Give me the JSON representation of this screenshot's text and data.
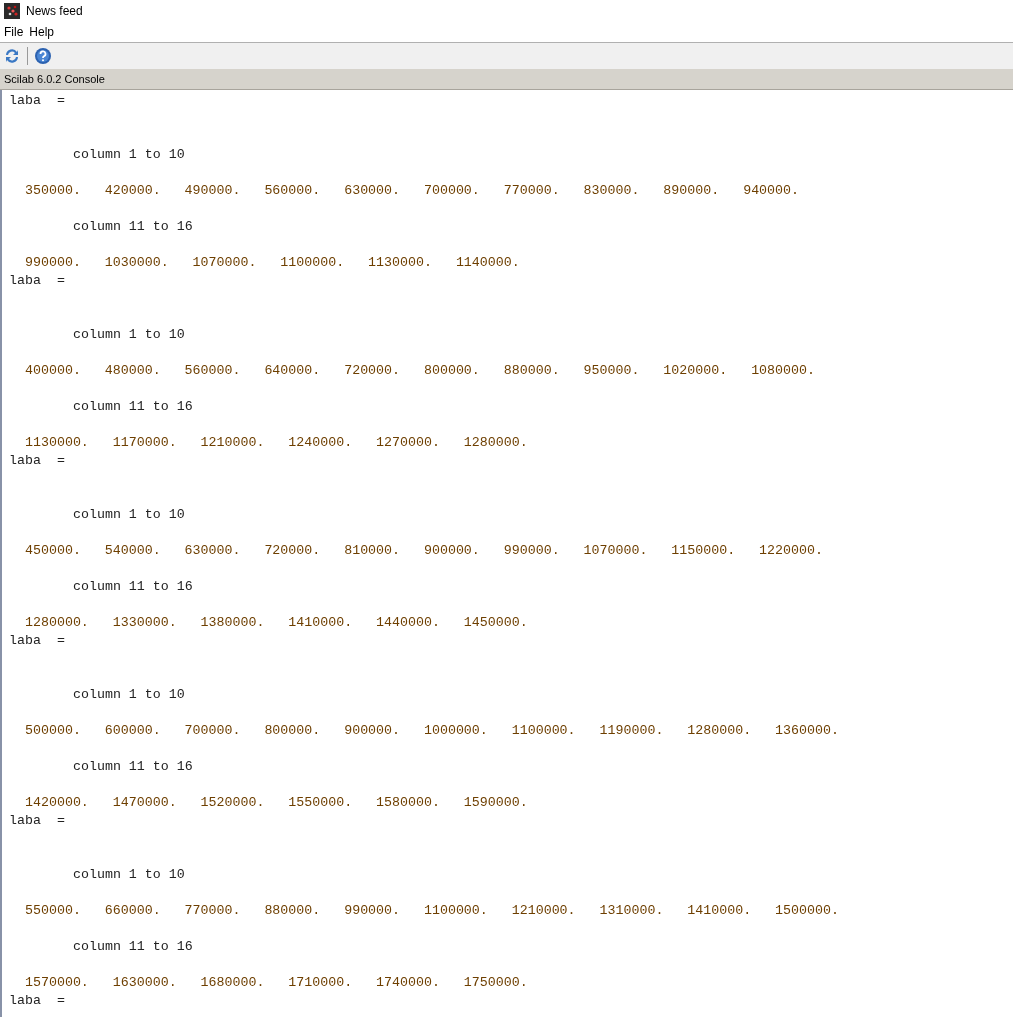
{
  "window": {
    "title": "News feed"
  },
  "menu": [
    "File",
    "Help"
  ],
  "toolbar": [
    {
      "kind": "refresh"
    },
    {
      "kind": "help"
    }
  ],
  "console": {
    "title": "Scilab 6.0.2 Console",
    "blocks": [
      {
        "name": "laba  =",
        "parts": [
          {
            "header": "column 1 to 10",
            "values": "350000.   420000.   490000.   560000.   630000.   700000.   770000.   830000.   890000.   940000."
          },
          {
            "header": "column 11 to 16",
            "values": "990000.   1030000.   1070000.   1100000.   1130000.   1140000."
          }
        ]
      },
      {
        "name": "laba  =",
        "parts": [
          {
            "header": "column 1 to 10",
            "values": "400000.   480000.   560000.   640000.   720000.   800000.   880000.   950000.   1020000.   1080000."
          },
          {
            "header": "column 11 to 16",
            "values": "1130000.   1170000.   1210000.   1240000.   1270000.   1280000."
          }
        ]
      },
      {
        "name": "laba  =",
        "parts": [
          {
            "header": "column 1 to 10",
            "values": "450000.   540000.   630000.   720000.   810000.   900000.   990000.   1070000.   1150000.   1220000."
          },
          {
            "header": "column 11 to 16",
            "values": "1280000.   1330000.   1380000.   1410000.   1440000.   1450000."
          }
        ]
      },
      {
        "name": "laba  =",
        "parts": [
          {
            "header": "column 1 to 10",
            "values": "500000.   600000.   700000.   800000.   900000.   1000000.   1100000.   1190000.   1280000.   1360000."
          },
          {
            "header": "column 11 to 16",
            "values": "1420000.   1470000.   1520000.   1550000.   1580000.   1590000."
          }
        ]
      },
      {
        "name": "laba  =",
        "parts": [
          {
            "header": "column 1 to 10",
            "values": "550000.   660000.   770000.   880000.   990000.   1100000.   1210000.   1310000.   1410000.   1500000."
          },
          {
            "header": "column 11 to 16",
            "values": "1570000.   1630000.   1680000.   1710000.   1740000.   1750000."
          }
        ]
      },
      {
        "name": "laba  ="
      }
    ]
  }
}
